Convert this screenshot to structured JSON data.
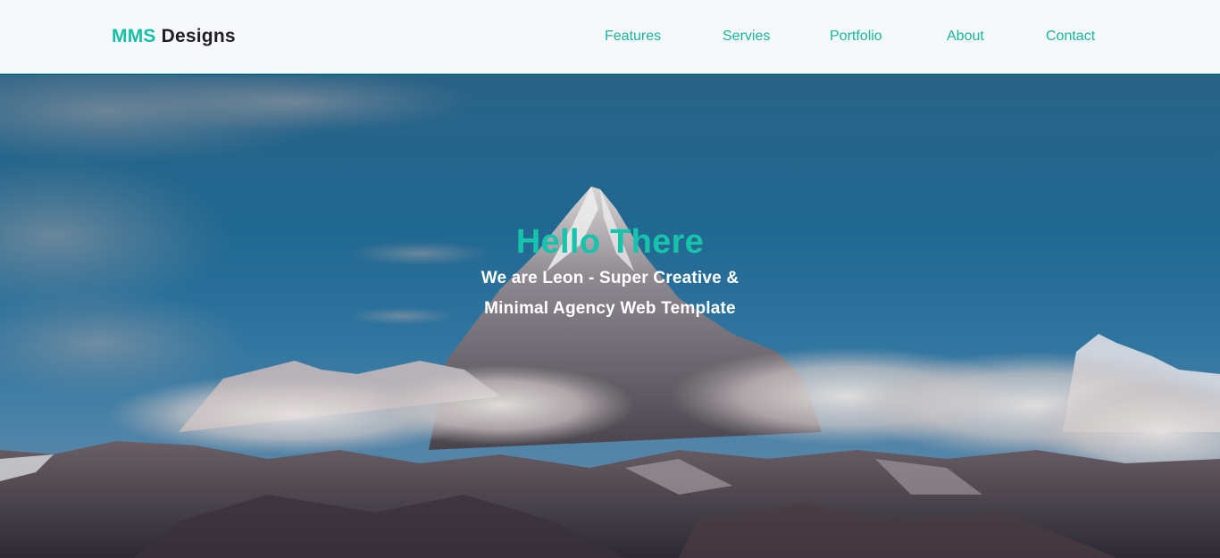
{
  "brand": {
    "accent": "MMS",
    "rest": "Designs"
  },
  "nav": {
    "items": [
      {
        "label": "Features"
      },
      {
        "label": "Servies"
      },
      {
        "label": "Portfolio"
      },
      {
        "label": "About"
      },
      {
        "label": "Contact"
      }
    ]
  },
  "hero": {
    "title": "Hello There",
    "subtitle_line1": "We are Leon - Super Creative &",
    "subtitle_line2": "Minimal Agency Web Template",
    "background": "mountain-landscape-image"
  },
  "colors": {
    "accent": "#16bfa6",
    "nav_bg": "#f7f8fa",
    "text_dark": "#1f1f23"
  }
}
